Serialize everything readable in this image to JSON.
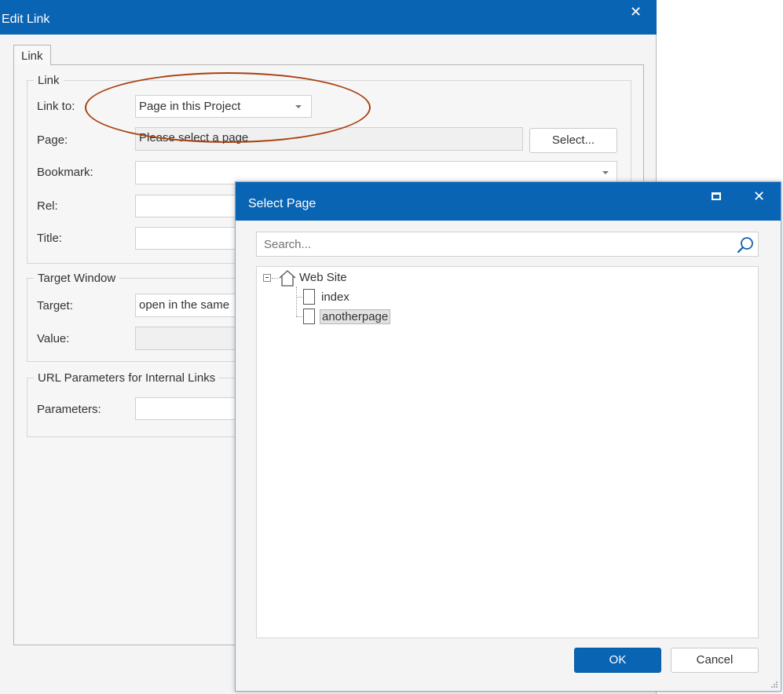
{
  "edit_link": {
    "title": "Edit Link",
    "close": "✕",
    "tab": "Link",
    "link_group": {
      "legend": "Link",
      "link_to_label": "Link to:",
      "link_to_value": "Page in this Project",
      "page_label": "Page:",
      "page_value": "Please select a page",
      "select_button": "Select...",
      "bookmark_label": "Bookmark:",
      "rel_label": "Rel:",
      "title_label": "Title:"
    },
    "target_group": {
      "legend": "Target Window",
      "target_label": "Target:",
      "target_value": "open in the same",
      "value_label": "Value:"
    },
    "url_group": {
      "legend": "URL Parameters for Internal Links",
      "parameters_label": "Parameters:"
    },
    "annotation_color": "#a84010"
  },
  "select_page": {
    "title": "Select Page",
    "close": "✕",
    "search_placeholder": "Search...",
    "tree": {
      "root": "Web Site",
      "children": [
        "index",
        "anotherpage"
      ],
      "selected": "anotherpage"
    },
    "ok": "OK",
    "cancel": "Cancel"
  },
  "colors": {
    "titlebar": "#0a64b4",
    "ok_button": "#0a64b4",
    "background": "#f4f4f4"
  }
}
